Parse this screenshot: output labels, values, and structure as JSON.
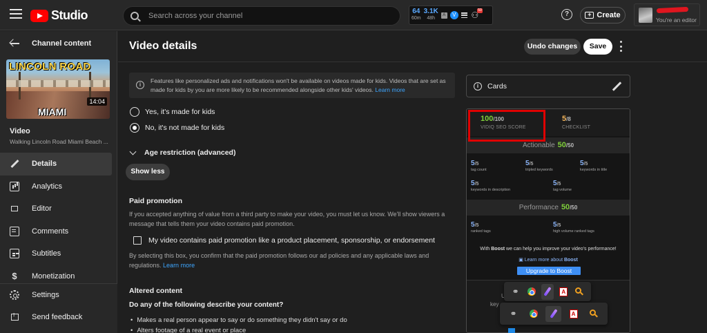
{
  "header": {
    "app_name": "Studio",
    "search_placeholder": "Search across your channel",
    "stats": [
      {
        "value": "64",
        "sub": "60m"
      },
      {
        "value": "3.1K",
        "sub": "48h"
      }
    ],
    "ab_badge": "A",
    "vidiq_logo": "V",
    "ext_badge": "59",
    "create_label": "Create",
    "account_role": "You're an editor",
    "icons": [
      "menu-icon",
      "youtube-logo",
      "search-icon",
      "vidiq-icon",
      "list-icon",
      "extension-icon",
      "help-icon",
      "create-icon",
      "avatar"
    ]
  },
  "sidebar": {
    "back_label": "Channel content",
    "thumbnail": {
      "top_text": "LINCOLN ROAD",
      "bottom_text": "MIAMI",
      "duration": "14:04"
    },
    "video_label": "Video",
    "video_title": "Walking Lincoln Road Miami Beach ...",
    "nav": [
      {
        "label": "Details",
        "icon": "pencil-icon",
        "active": true
      },
      {
        "label": "Analytics",
        "icon": "analytics-icon"
      },
      {
        "label": "Editor",
        "icon": "editor-icon"
      },
      {
        "label": "Comments",
        "icon": "comments-icon"
      },
      {
        "label": "Subtitles",
        "icon": "subtitles-icon"
      },
      {
        "label": "Monetization",
        "icon": "dollar-icon"
      }
    ],
    "bottom": [
      {
        "label": "Settings",
        "icon": "gear-icon"
      },
      {
        "label": "Send feedback",
        "icon": "feedback-icon"
      }
    ]
  },
  "main": {
    "title": "Video details",
    "undo_label": "Undo changes",
    "save_label": "Save",
    "kids_info": "Features like personalized ads and notifications won't be available on videos made for kids. Videos that are set as made for kids by you are more likely to be recommended alongside other kids' videos.",
    "learn_more": "Learn more",
    "radio_yes": "Yes, it's made for kids",
    "radio_no": "No, it's not made for kids",
    "age_restriction": "Age restriction (advanced)",
    "show_less": "Show less",
    "paid_promotion_heading": "Paid promotion",
    "paid_promotion_text": "If you accepted anything of value from a third party to make your video, you must let us know. We'll show viewers a message that tells them your video contains paid promotion.",
    "paid_checkbox_label": "My video contains paid promotion like a product placement, sponsorship, or endorsement",
    "paid_confirm_text": "By selecting this box, you confirm that the paid promotion follows our ad policies and any applicable laws and regulations.",
    "altered_heading": "Altered content",
    "altered_question": "Do any of the following describe your content?",
    "altered_bullets": [
      "Makes a real person appear to say or do something they didn't say or do",
      "Alters footage of a real event or place"
    ]
  },
  "right": {
    "cards_label": "Cards",
    "vidiq": {
      "seo_score": "100",
      "seo_den": "/100",
      "seo_label": "VIDIQ SEO SCORE",
      "checklist_score": "5",
      "checklist_den": "/8",
      "checklist_label": "CHECKLIST",
      "actionable_label": "Actionable",
      "actionable_score": "50",
      "actionable_den": "/50",
      "actionable_metrics": [
        {
          "v": "5",
          "den": "/5",
          "l": "tag count"
        },
        {
          "v": "5",
          "den": "/5",
          "l": "tripled keywords"
        },
        {
          "v": "5",
          "den": "/5",
          "l": "keywords in title"
        },
        {
          "v": "5",
          "den": "/5",
          "l": "keywords in description"
        },
        {
          "v": "5",
          "den": "/5",
          "l": "tag volume"
        }
      ],
      "performance_label": "Performance",
      "performance_score": "50",
      "performance_den": "/50",
      "performance_metrics": [
        {
          "v": "5",
          "den": "/5",
          "l": "ranked tags"
        },
        {
          "v": "5",
          "den": "/5",
          "l": "high volume ranked tags"
        }
      ],
      "boost_text_pre": "With ",
      "boost_text_bold": "Boost",
      "boost_text_post": " we can help you improve your video's performance!",
      "boost_link": "Learn more about ",
      "boost_link_bold": "Boost",
      "boost_button": "Upgrade to Boost",
      "lower_fragments": [
        "U",
        "key"
      ]
    }
  },
  "tray": {
    "icons": [
      "link-icon",
      "chrome-icon",
      "feather-icon",
      "pdf-icon",
      "magnifier-icon"
    ],
    "pdf_glyph": "A"
  },
  "colors": {
    "accent_green": "#7fcf3a",
    "accent_orange": "#f2b35a",
    "highlight_red": "#e00000",
    "link_blue": "#3ea6ff"
  }
}
